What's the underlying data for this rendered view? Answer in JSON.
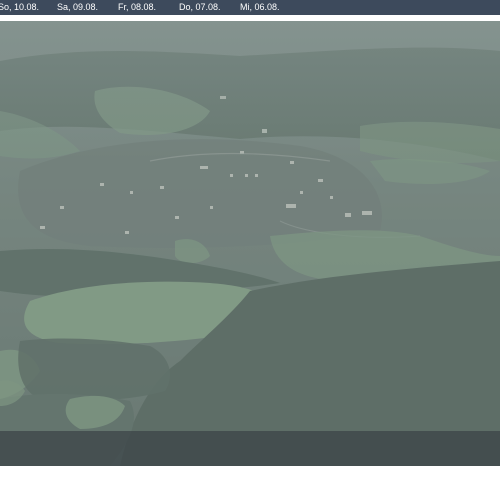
{
  "day_tabs": [
    {
      "label": "So, 10.08."
    },
    {
      "label": "Sa, 09.08."
    },
    {
      "label": "Fr, 08.08."
    },
    {
      "label": "Do, 07.08."
    },
    {
      "label": "Mi, 06.08."
    }
  ],
  "colors": {
    "topbar": "#3d4a5c",
    "haze": "#7b8a86",
    "bottom_overlay": "#3a4246"
  }
}
